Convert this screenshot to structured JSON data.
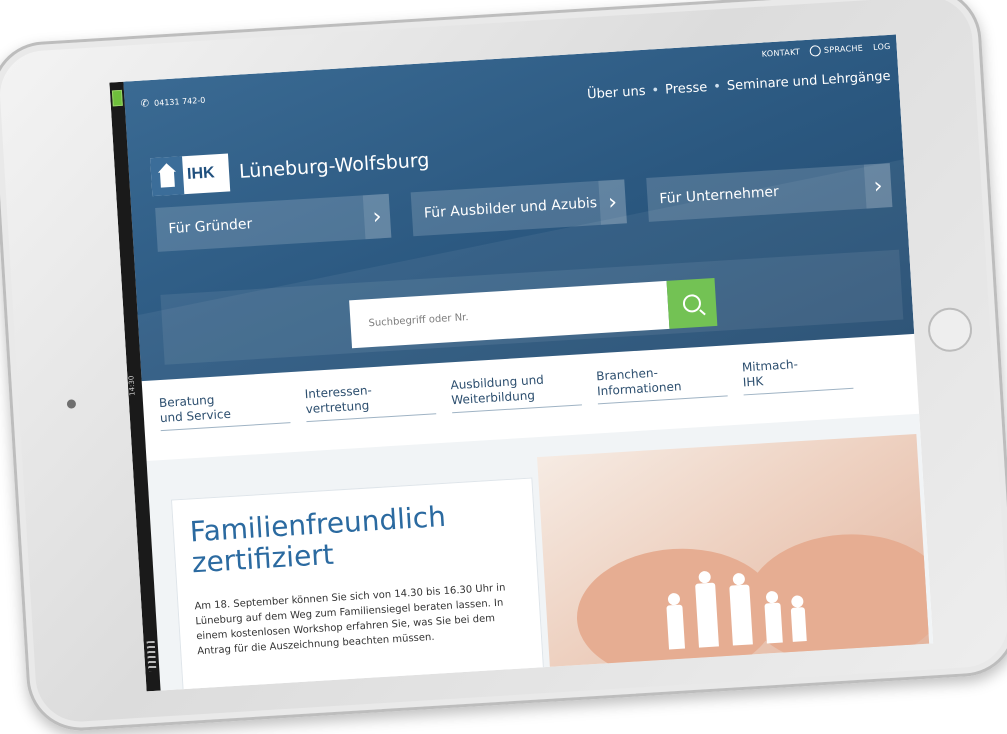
{
  "topbar": {
    "contact": "KONTAKT",
    "language": "SPRACHE",
    "login": "LOG"
  },
  "phone": "04131 742-0",
  "secondary_nav": {
    "items": [
      "Über uns",
      "Presse",
      "Seminare und Lehrgänge"
    ]
  },
  "logo": {
    "ihk": "IHK",
    "name": "Lüneburg-Wolfsburg"
  },
  "topics": [
    {
      "label": "Für Gründer",
      "arrow": "›"
    },
    {
      "label": "Für Ausbilder und Azubis",
      "arrow": "›"
    },
    {
      "label": "Für Unternehmer",
      "arrow": "›"
    }
  ],
  "search": {
    "placeholder": "Suchbegriff oder Nr."
  },
  "main_nav": {
    "items": [
      {
        "line1": "Beratung",
        "line2": "und Service"
      },
      {
        "line1": "Interessen-",
        "line2": "vertretung"
      },
      {
        "line1": "Ausbildung und",
        "line2": "Weiterbildung"
      },
      {
        "line1": "Branchen-",
        "line2": "Informationen"
      },
      {
        "line1": "Mitmach-",
        "line2": "IHK"
      }
    ]
  },
  "teaser": {
    "title_line1": "Familienfreundlich",
    "title_line2": "zertifiziert",
    "text": "Am 18. September können Sie sich von 14.30 bis 16.30 Uhr in Lüneburg auf dem Weg zum Familiensiegel beraten lassen. In einem kostenlosen Workshop erfahren Sie, was Sie bei dem Antrag für die Auszeichnung beachten müssen."
  },
  "device": {
    "status_time": "14:30"
  },
  "colors": {
    "header_blue": "#2b5880",
    "accent_green": "#6bbf4a",
    "title_blue": "#2b6aa0"
  }
}
